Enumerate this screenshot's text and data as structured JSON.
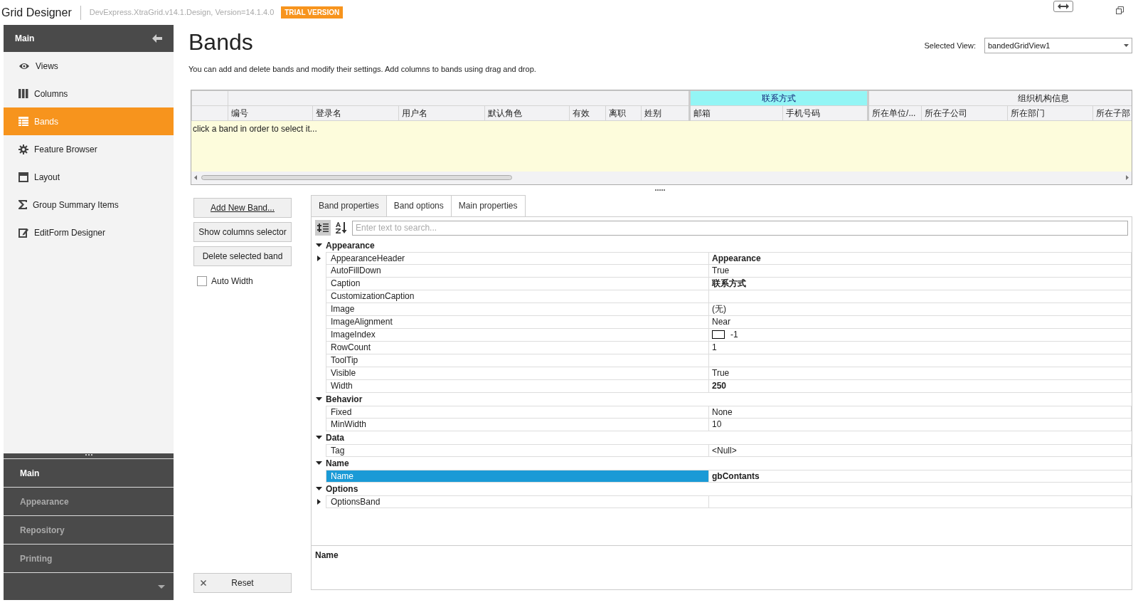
{
  "window": {
    "title": "Grid Designer",
    "version": "DevExpress.XtraGrid.v14.1.Design, Version=14.1.4.0",
    "badge": "TRIAL VERSION"
  },
  "sidebar": {
    "header": "Main",
    "items": [
      {
        "label": "Views",
        "selected": false
      },
      {
        "label": "Columns",
        "selected": false
      },
      {
        "label": "Bands",
        "selected": true
      },
      {
        "label": "Feature Browser",
        "selected": false
      },
      {
        "label": "Layout",
        "selected": false
      },
      {
        "label": "Group Summary Items",
        "selected": false
      },
      {
        "label": "EditForm Designer",
        "selected": false
      }
    ],
    "groups": [
      {
        "label": "Main",
        "selected": true
      },
      {
        "label": "Appearance",
        "selected": false
      },
      {
        "label": "Repository",
        "selected": false
      },
      {
        "label": "Printing",
        "selected": false
      }
    ]
  },
  "page": {
    "title": "Bands",
    "description": "You can add and delete bands and modify their settings. Add columns to bands using drag and drop.",
    "selected_view_label": "Selected View:",
    "selected_view": "bandedGridView1"
  },
  "grid": {
    "bands": [
      {
        "selected": false,
        "columns": [
          "编号",
          "登录名",
          "用户名",
          "默认角色",
          "有效",
          "离职",
          "姓别"
        ]
      },
      {
        "caption": "联系方式",
        "selected": true,
        "columns": [
          "邮箱",
          "手机号码"
        ]
      },
      {
        "caption": "组织机构信息",
        "selected": false,
        "columns": [
          "所在单位/...",
          "所在子公司",
          "所在部门",
          "所在子部"
        ]
      }
    ],
    "hint": "click a band in order to select it..."
  },
  "buttons": {
    "add": "Add New Band...",
    "columns": "Show columns selector",
    "delete": "Delete selected band",
    "auto_width": {
      "label": "Auto Width",
      "checked": false
    },
    "reset": "Reset"
  },
  "tabs": [
    {
      "label": "Band properties",
      "selected": true
    },
    {
      "label": "Band options",
      "selected": false
    },
    {
      "label": "Main properties",
      "selected": false
    }
  ],
  "properties": {
    "search_placeholder": "Enter text to search...",
    "categorized": true,
    "categories": [
      {
        "name": "Appearance",
        "expanded": true,
        "rows": [
          {
            "name": "AppearanceHeader",
            "value": "Appearance",
            "modified": true,
            "expandable": true,
            "selected": false
          },
          {
            "name": "AutoFillDown",
            "value": "True",
            "modified": false,
            "expandable": false,
            "selected": false
          },
          {
            "name": "Caption",
            "value": "联系方式",
            "modified": true,
            "expandable": false,
            "selected": false
          },
          {
            "name": "CustomizationCaption",
            "expandable": false,
            "selected": false
          },
          {
            "name": "Image",
            "value": "(无)",
            "modified": false,
            "expandable": false,
            "selected": false
          },
          {
            "name": "ImageAlignment",
            "value": "Near",
            "modified": false,
            "expandable": false,
            "selected": false
          },
          {
            "name": "ImageIndex",
            "value": "-1",
            "kind": "image",
            "modified": false,
            "expandable": false,
            "selected": false
          },
          {
            "name": "RowCount",
            "value": "1",
            "modified": false,
            "expandable": false,
            "selected": false
          },
          {
            "name": "ToolTip",
            "expandable": false,
            "selected": false
          },
          {
            "name": "Visible",
            "value": "True",
            "modified": false,
            "expandable": false,
            "selected": false
          },
          {
            "name": "Width",
            "value": "250",
            "modified": true,
            "expandable": false,
            "selected": false
          }
        ]
      },
      {
        "name": "Behavior",
        "expanded": true,
        "rows": [
          {
            "name": "Fixed",
            "value": "None",
            "modified": false,
            "expandable": false,
            "selected": false
          },
          {
            "name": "MinWidth",
            "value": "10",
            "modified": false,
            "expandable": false,
            "selected": false
          }
        ]
      },
      {
        "name": "Data",
        "expanded": true,
        "rows": [
          {
            "name": "Tag",
            "value": "<Null>",
            "modified": false,
            "expandable": false,
            "selected": false
          }
        ]
      },
      {
        "name": "Name",
        "expanded": true,
        "rows": [
          {
            "name": "Name",
            "value": "gbContants",
            "modified": true,
            "expandable": false,
            "selected": true
          }
        ]
      },
      {
        "name": "Options",
        "expanded": true,
        "rows": [
          {
            "name": "OptionsBand",
            "expandable": true,
            "selected": false
          }
        ]
      }
    ],
    "description_title": "Name"
  }
}
